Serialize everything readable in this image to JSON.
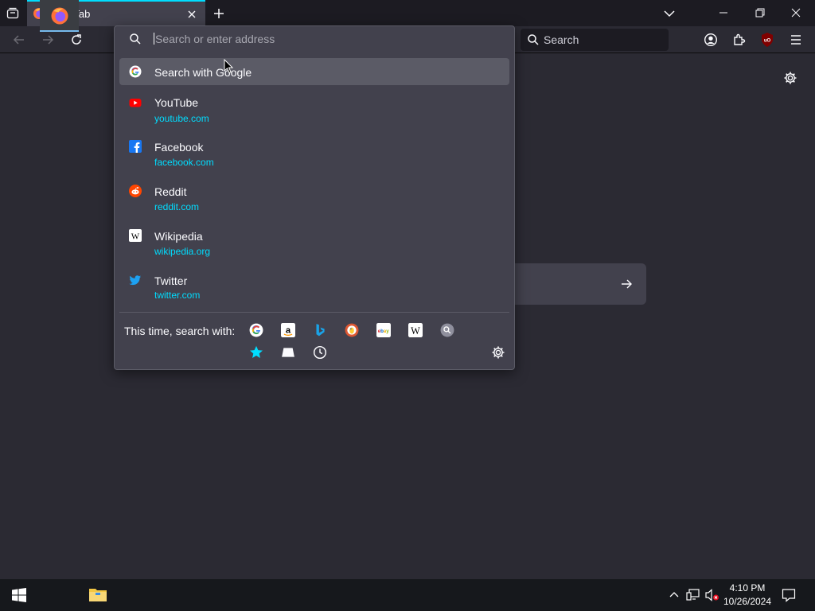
{
  "browser": {
    "tab_title": "New Tab",
    "search_placeholder": "Search"
  },
  "urlbar": {
    "placeholder": "Search or enter address",
    "suggestions": [
      {
        "title": "Search with Google",
        "url": "",
        "icon": "google-icon"
      },
      {
        "title": "YouTube",
        "url": "youtube.com",
        "icon": "youtube-icon"
      },
      {
        "title": "Facebook",
        "url": "facebook.com",
        "icon": "facebook-icon"
      },
      {
        "title": "Reddit",
        "url": "reddit.com",
        "icon": "reddit-icon"
      },
      {
        "title": "Wikipedia",
        "url": "wikipedia.org",
        "icon": "wikipedia-icon"
      },
      {
        "title": "Twitter",
        "url": "twitter.com",
        "icon": "twitter-icon"
      }
    ],
    "one_off_label": "This time, search with:",
    "one_off_engines": [
      "google-icon",
      "amazon-icon",
      "bing-icon",
      "duckduckgo-icon",
      "ebay-icon",
      "wikipedia-icon",
      "search-engine-icon",
      "bookmarks-star-icon",
      "tabs-icon",
      "history-clock-icon"
    ]
  },
  "taskbar": {
    "time": "4:10 PM",
    "date": "10/26/2024"
  },
  "colors": {
    "accent": "#00ddff",
    "panel_bg": "#42414d",
    "toolbar_bg": "#2b2a33",
    "titlebar_bg": "#1c1b22"
  }
}
